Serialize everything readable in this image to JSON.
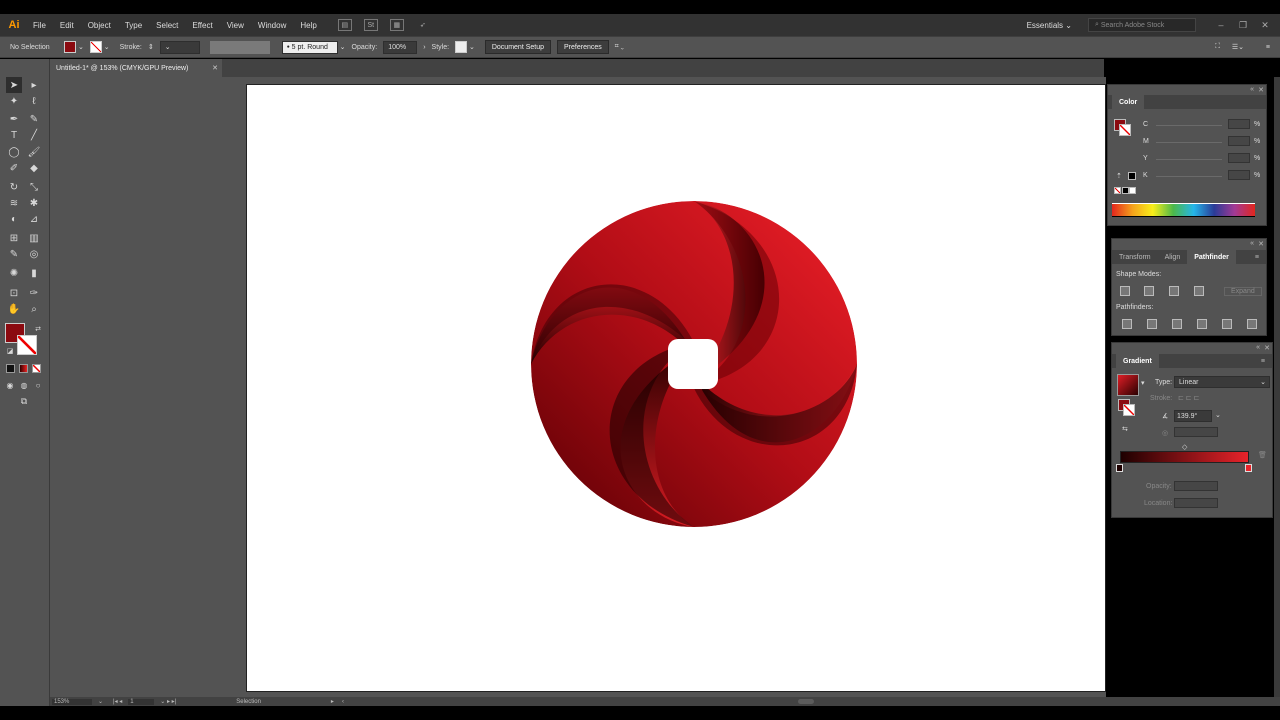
{
  "app": {
    "logo": "Ai"
  },
  "menu": [
    "File",
    "Edit",
    "Object",
    "Type",
    "Select",
    "Effect",
    "View",
    "Window",
    "Help"
  ],
  "menu_right": {
    "workspace": "Essentials",
    "search_placeholder": "Search Adobe Stock"
  },
  "controls": {
    "selection": "No Selection",
    "stroke_label": "Stroke:",
    "brush": "5 pt. Round",
    "opacity_label": "Opacity:",
    "opacity": "100%",
    "style_label": "Style:",
    "document_setup": "Document Setup",
    "preferences": "Preferences"
  },
  "document": {
    "tab_title": "Untitled-1* @ 153% (CMYK/GPU Preview)"
  },
  "color_panel": {
    "title": "Color",
    "channels": [
      "C",
      "M",
      "Y",
      "K"
    ],
    "unit": "%"
  },
  "pathfinder_panel": {
    "tabs": [
      "Transform",
      "Align",
      "Pathfinder"
    ],
    "active_tab": "Pathfinder",
    "shape_modes": "Shape Modes:",
    "expand": "Expand",
    "pathfinders": "Pathfinders:"
  },
  "gradient_panel": {
    "title": "Gradient",
    "type_label": "Type:",
    "type_value": "Linear",
    "stroke_label": "Stroke:",
    "angle": "139.9°",
    "opacity_label": "Opacity:",
    "location_label": "Location:"
  },
  "status": {
    "zoom": "153%",
    "artboard": "1",
    "tool": "Selection"
  },
  "colors": {
    "fill": "#8b0a10",
    "gradient_dark": "#3a0000",
    "gradient_light": "#e8232a",
    "accent": "#ff9a00"
  }
}
